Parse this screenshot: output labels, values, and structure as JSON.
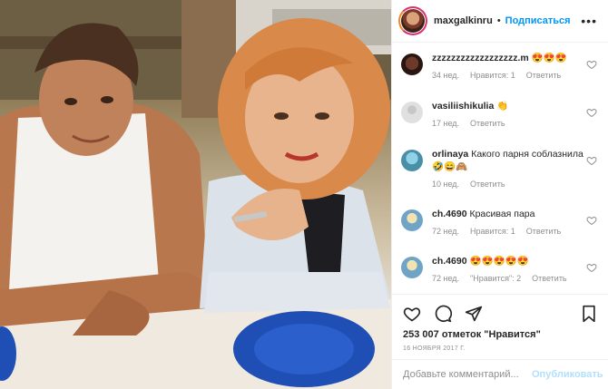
{
  "post": {
    "username": "maxgalkinru",
    "separator": "•",
    "follow_label": "Подписаться",
    "more_label": "•••",
    "likes_text": "253 007 отметок \"Нравится\"",
    "date_text": "16 ноября 2017 г."
  },
  "comments": [
    {
      "username": "zzzzzzzzzzzzzzzzzz.m",
      "text": "😍😍😍",
      "time": "34 нед.",
      "likes": "Нравится: 1",
      "reply": "Ответить"
    },
    {
      "username": "vasiliishikulia",
      "text": "👏",
      "time": "17 нед.",
      "likes": "",
      "reply": "Ответить"
    },
    {
      "username": "orlinaya",
      "text": "Какого парня соблазнила🤣😄🙈",
      "time": "10 нед.",
      "likes": "",
      "reply": "Ответить"
    },
    {
      "username": "ch.4690",
      "text": "Красивая пара",
      "time": "72 нед.",
      "likes": "Нравится: 1",
      "reply": "Ответить"
    },
    {
      "username": "ch.4690",
      "text": "😍😍😍😍😍",
      "time": "72 нед.",
      "likes": "\"Нравится\": 2",
      "reply": "Ответить"
    }
  ],
  "add_comment": {
    "placeholder": "Добавьте комментарий...",
    "publish_label": "Опубликовать"
  },
  "icons": [
    "heart-icon",
    "comment-icon",
    "share-icon",
    "bookmark-icon"
  ],
  "colors": {
    "follow": "#0095f6",
    "publish_disabled": "#b2dffc",
    "meta": "#8e8e8e"
  }
}
